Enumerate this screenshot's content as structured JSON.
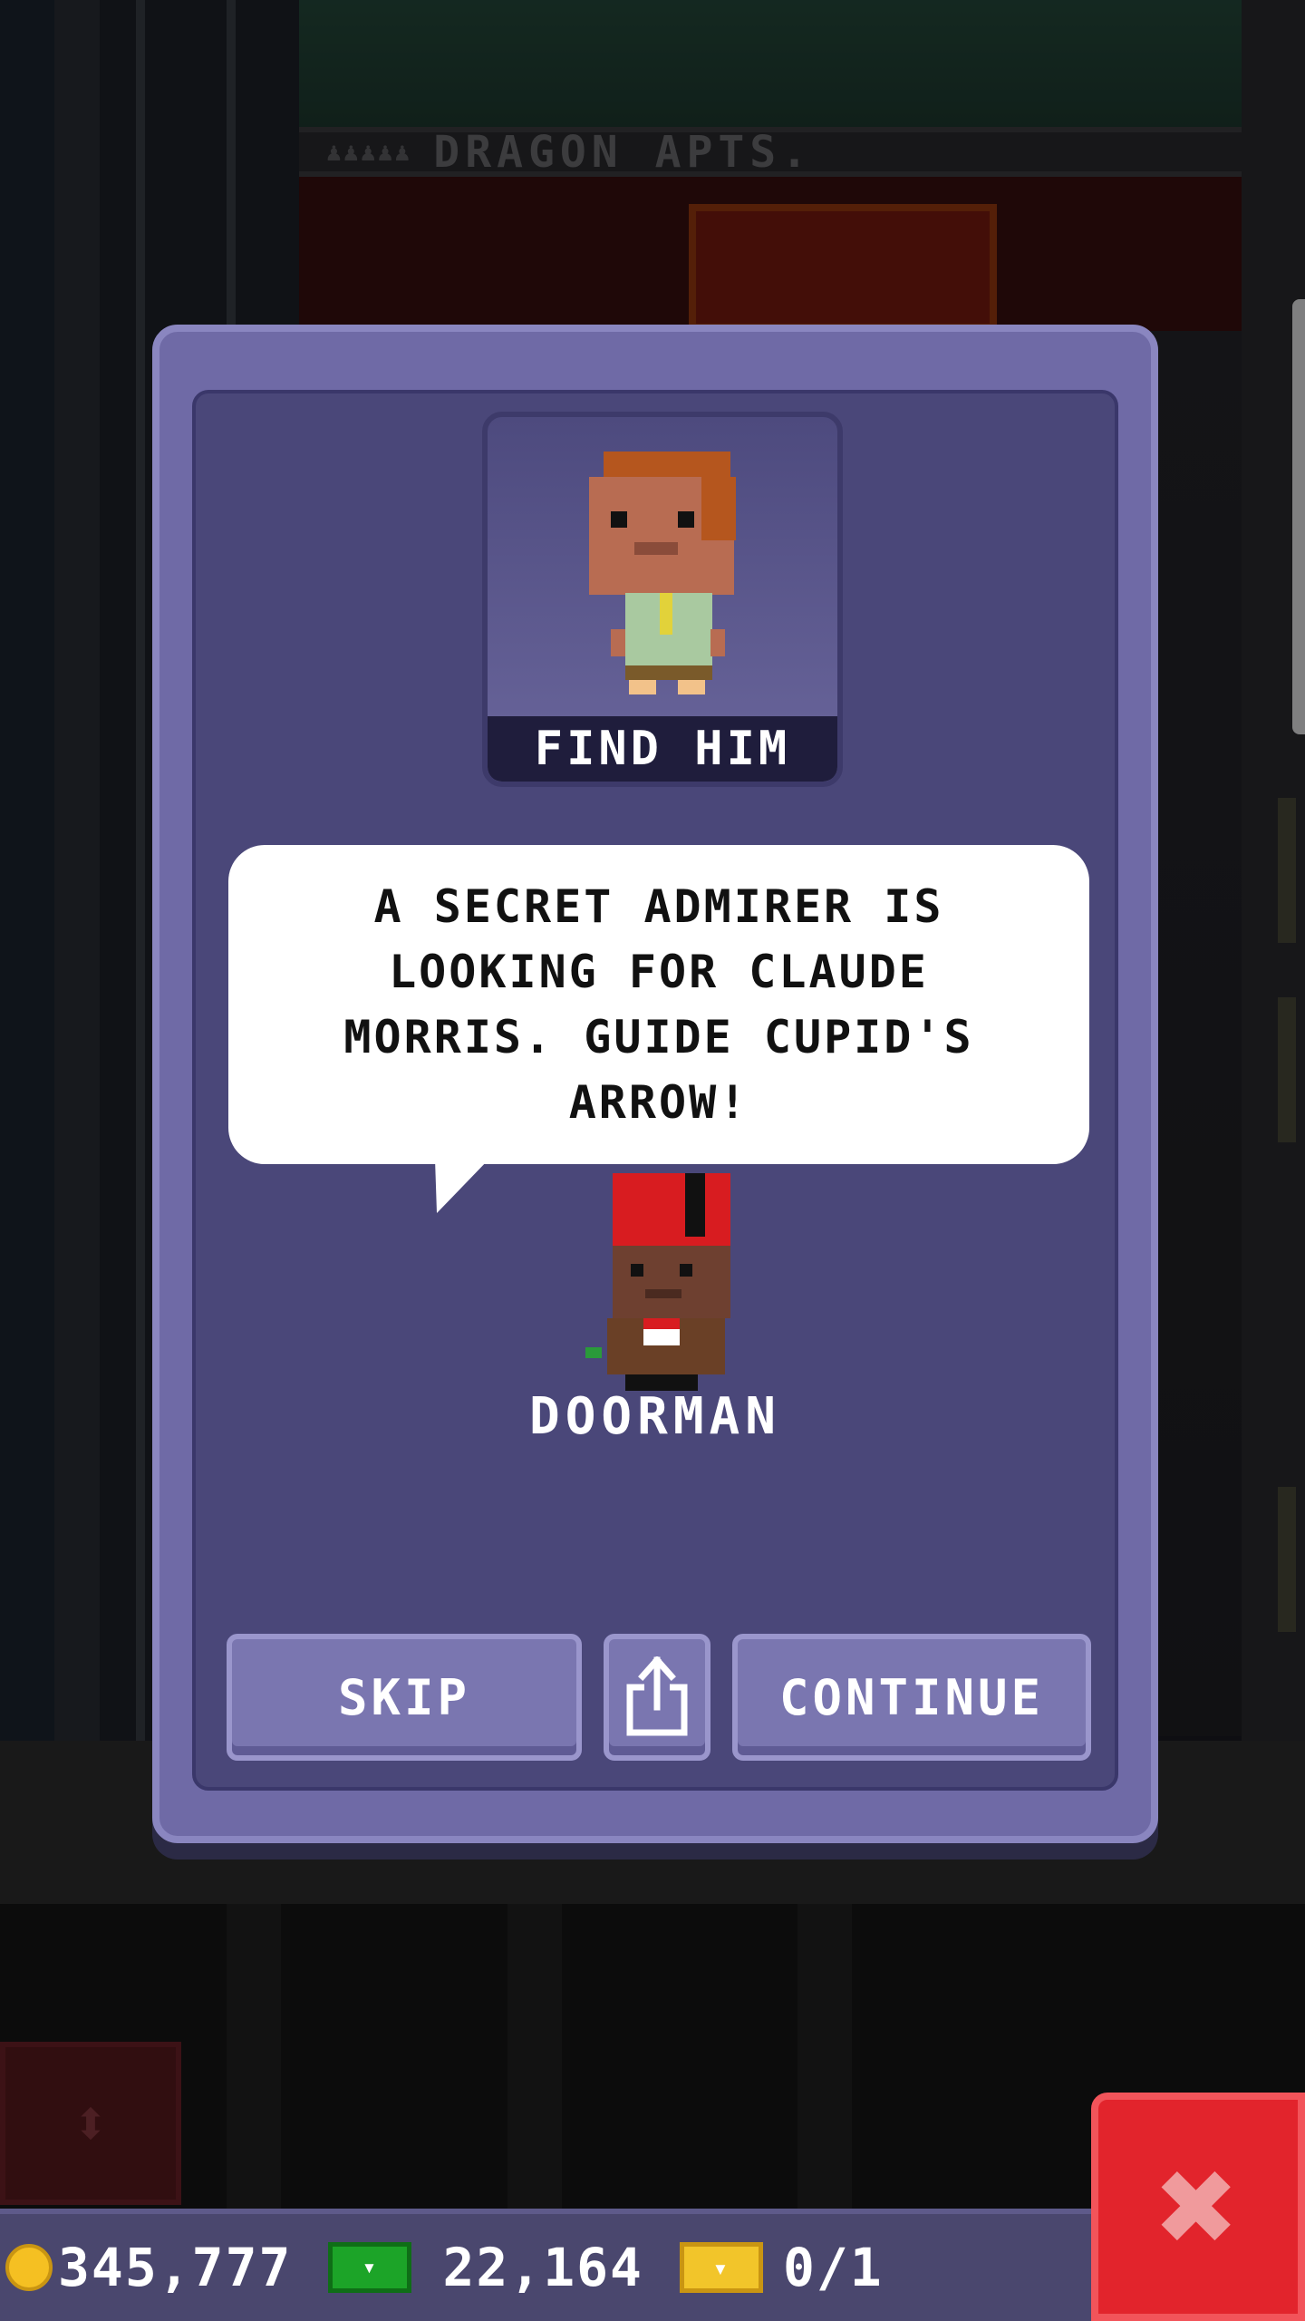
{
  "background": {
    "sign": "DRAGON APTS.",
    "tenant_icons": "♟♟♟♟♟"
  },
  "mission": {
    "portrait_label": "FIND HIM",
    "message": "A SECRET ADMIRER IS LOOKING FOR CLAUDE MORRIS. GUIDE CUPID'S ARROW!",
    "speaker": "DOORMAN"
  },
  "buttons": {
    "skip": "SKIP",
    "continue": "CONTINUE",
    "share_icon": "share-icon",
    "close_icon": "close-icon",
    "close_glyph": "✖",
    "elevator_icon": "elevator-arrows-icon",
    "elevator_glyph": "⬍"
  },
  "status_bar": {
    "coins": "345,777",
    "bux": "22,164",
    "tickets": "0/1"
  },
  "colors": {
    "modal": "#6f6aa6",
    "modal_inner": "#4a4779",
    "close": "#e2242c",
    "coin": "#f5c022",
    "bux": "#1ca428"
  }
}
